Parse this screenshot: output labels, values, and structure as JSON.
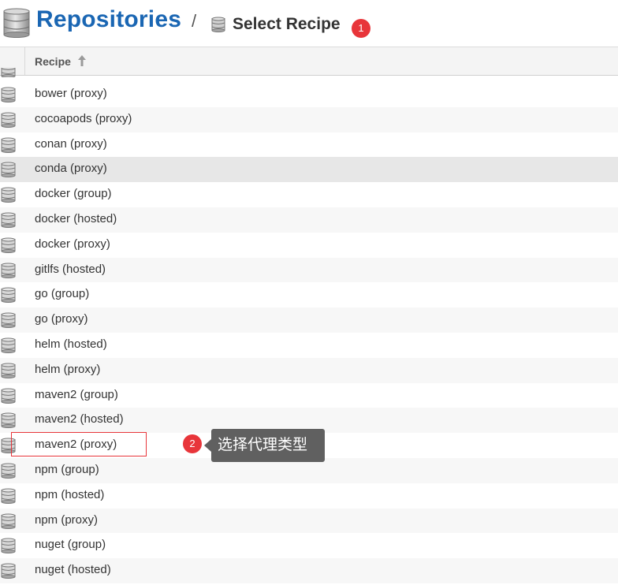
{
  "header": {
    "title": "Repositories",
    "separator": "/",
    "subtitle": "Select Recipe",
    "icon": "database-icon"
  },
  "annotations": {
    "badge_1": "1",
    "badge_2": "2",
    "tooltip": "选择代理类型",
    "highlight_color": "#e8353a"
  },
  "table": {
    "column_header": "Recipe",
    "sort": "ascending",
    "rows": [
      {
        "label": "bower (proxy)"
      },
      {
        "label": "cocoapods (proxy)"
      },
      {
        "label": "conan (proxy)"
      },
      {
        "label": "conda (proxy)"
      },
      {
        "label": "docker (group)"
      },
      {
        "label": "docker (hosted)"
      },
      {
        "label": "docker (proxy)"
      },
      {
        "label": "gitlfs (hosted)"
      },
      {
        "label": "go (group)"
      },
      {
        "label": "go (proxy)"
      },
      {
        "label": "helm (hosted)"
      },
      {
        "label": "helm (proxy)"
      },
      {
        "label": "maven2 (group)"
      },
      {
        "label": "maven2 (hosted)"
      },
      {
        "label": "maven2 (proxy)"
      },
      {
        "label": "npm (group)"
      },
      {
        "label": "npm (hosted)"
      },
      {
        "label": "npm (proxy)"
      },
      {
        "label": "nuget (group)"
      },
      {
        "label": "nuget (hosted)"
      }
    ]
  },
  "colors": {
    "title_blue": "#1a66b3",
    "row_hover": "#e7e7e7",
    "tooltip_bg": "#606060"
  }
}
